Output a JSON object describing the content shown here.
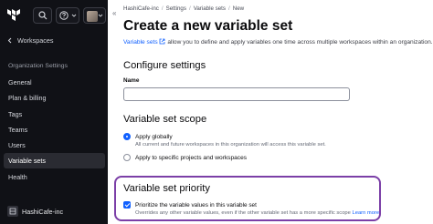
{
  "sidebar": {
    "workspaces_label": "Workspaces",
    "org_settings_label": "Organization Settings",
    "items": [
      {
        "label": "General"
      },
      {
        "label": "Plan & billing"
      },
      {
        "label": "Tags"
      },
      {
        "label": "Teams"
      },
      {
        "label": "Users"
      },
      {
        "label": "Variable sets",
        "active": true
      },
      {
        "label": "Health"
      }
    ],
    "org_name": "HashiCafe-inc"
  },
  "breadcrumb": {
    "org": "HashiCafe-inc",
    "settings": "Settings",
    "variable_sets": "Variable sets",
    "current": "New"
  },
  "page": {
    "title": "Create a new variable set",
    "desc_link": "Variable sets",
    "desc_text": " allow you to define and apply variables one time across multiple workspaces within an organization."
  },
  "configure": {
    "heading": "Configure settings",
    "name_label": "Name",
    "name_value": ""
  },
  "scope": {
    "heading": "Variable set scope",
    "apply_globally": "Apply globally",
    "apply_globally_help": "All current and future workspaces in this organization will access this variable set.",
    "apply_specific": "Apply to specific projects and workspaces",
    "selected": "apply_globally"
  },
  "priority": {
    "heading": "Variable set priority",
    "checkbox_label": "Prioritize the variable values in this variable set",
    "checked": true,
    "help": "Overrides any other variable values, even if the other variable set has a more specific scope",
    "learn_more": "Learn more"
  },
  "colors": {
    "sidebar_bg": "#101116",
    "accent": "#1060ff",
    "highlight": "#7b3fa7"
  }
}
